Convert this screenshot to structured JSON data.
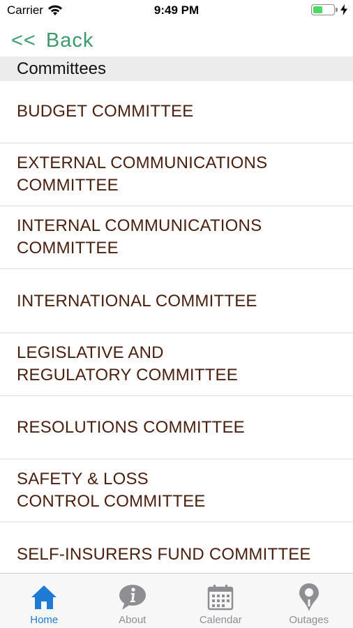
{
  "status_bar": {
    "carrier": "Carrier",
    "time": "9:49 PM",
    "battery_level": 0.45
  },
  "nav": {
    "back_chevron": "<<",
    "back_label": "Back"
  },
  "section": {
    "title": "Committees"
  },
  "committees": [
    {
      "label": "BUDGET COMMITTEE"
    },
    {
      "label": "EXTERNAL COMMUNICATIONS\nCOMMITTEE"
    },
    {
      "label": "INTERNAL COMMUNICATIONS\nCOMMITTEE"
    },
    {
      "label": "INTERNATIONAL COMMITTEE"
    },
    {
      "label": "LEGISLATIVE AND\nREGULATORY COMMITTEE"
    },
    {
      "label": "RESOLUTIONS COMMITTEE"
    },
    {
      "label": "SAFETY & LOSS\nCONTROL COMMITTEE"
    },
    {
      "label": "SELF-INSURERS FUND COMMITTEE"
    }
  ],
  "tab_bar": {
    "tabs": [
      {
        "label": "Home",
        "icon": "home-icon",
        "active": true
      },
      {
        "label": "About",
        "icon": "info-bubble-icon",
        "active": false
      },
      {
        "label": "Calendar",
        "icon": "calendar-icon",
        "active": false
      },
      {
        "label": "Outages",
        "icon": "map-pin-icon",
        "active": false
      }
    ]
  },
  "colors": {
    "accent_green": "#3c9a6f",
    "item_text": "#4a2010",
    "tab_active": "#1f7ad6",
    "tab_inactive": "#8e8e93"
  }
}
